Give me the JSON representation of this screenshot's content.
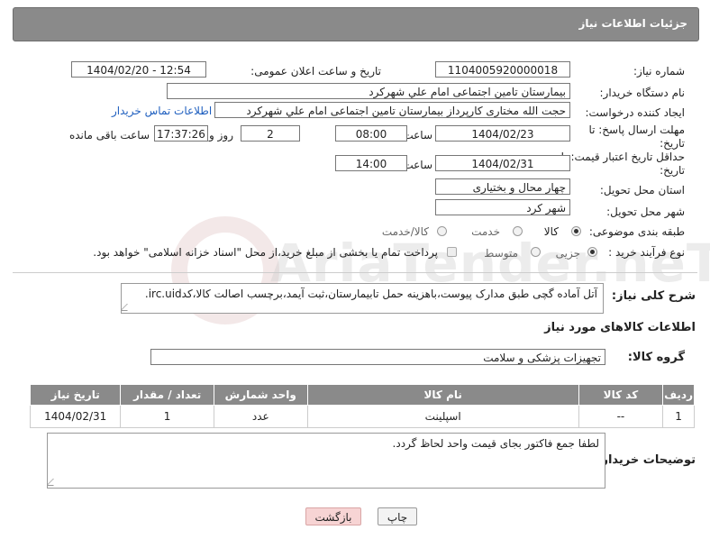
{
  "panel": {
    "title": "جزئیات اطلاعات نیاز"
  },
  "fields": {
    "need_number": {
      "label": "شماره نیاز:",
      "value": "1104005920000018"
    },
    "announce_datetime": {
      "label": "تاریخ و ساعت اعلان عمومی:",
      "value": "1404/02/20 - 12:54"
    },
    "buyer_org": {
      "label": "نام دستگاه خریدار:",
      "value": "بیمارستان تامین اجتماعی امام علي شهرکرد"
    },
    "requester": {
      "label": "ایجاد کننده درخواست:",
      "value": "حجت الله مختاری کارپرداز بیمارستان تامین اجتماعی امام علي شهرکرد",
      "contact_link": "اطلاعات تماس خریدار"
    },
    "reply_deadline": {
      "label": "مهلت ارسال پاسخ: تا تاریخ:",
      "date": "1404/02/23",
      "time_label": "ساعت",
      "time": "08:00",
      "days": "2",
      "days_label": "روز و",
      "remaining": "17:37:26",
      "remaining_label": "ساعت باقی مانده"
    },
    "price_validity": {
      "label": "حداقل تاریخ اعتبار قیمت: تا تاریخ:",
      "date": "1404/02/31",
      "time_label": "ساعت",
      "time": "14:00"
    },
    "province": {
      "label": "استان محل تحویل:",
      "value": "چهار محال و بختیاری"
    },
    "city": {
      "label": "شهر محل تحویل:",
      "value": "شهر کرد"
    },
    "category": {
      "label": "طبقه بندی موضوعی:",
      "options": [
        "کالا",
        "خدمت",
        "کالا/خدمت"
      ]
    },
    "purchase_type": {
      "label": "نوع فرآیند خرید :",
      "options": [
        "جزیی",
        "متوسط"
      ],
      "note": "پرداخت تمام یا بخشی از مبلغ خرید،از محل \"اسناد خزانه اسلامی\" خواهد بود."
    },
    "description": {
      "label": "شرح کلی نیاز:",
      "value": "آتل آماده گچی طبق مدارک پیوست،باهزینه حمل تابیمارستان،ثبت آیمد،برچسب اصالت کالا،کدirc.uid."
    }
  },
  "goods": {
    "section_title": "اطلاعات کالاهای مورد نیاز",
    "group_label": "گروه کالا:",
    "group_value": "تجهیزات پزشکی و سلامت",
    "columns": [
      "ردیف",
      "کد کالا",
      "نام کالا",
      "واحد شمارش",
      "تعداد / مقدار",
      "تاریخ نیاز"
    ],
    "rows": [
      [
        "1",
        "--",
        "اسپلینت",
        "عدد",
        "1",
        "1404/02/31"
      ]
    ]
  },
  "buyer_notes": {
    "label": "توضیحات خریدار:",
    "value": "لطفا جمع فاکتور بجای قیمت واحد لحاظ گردد."
  },
  "buttons": {
    "print": "چاپ",
    "back": "بازگشت"
  },
  "watermark": "AriaTender.neT"
}
